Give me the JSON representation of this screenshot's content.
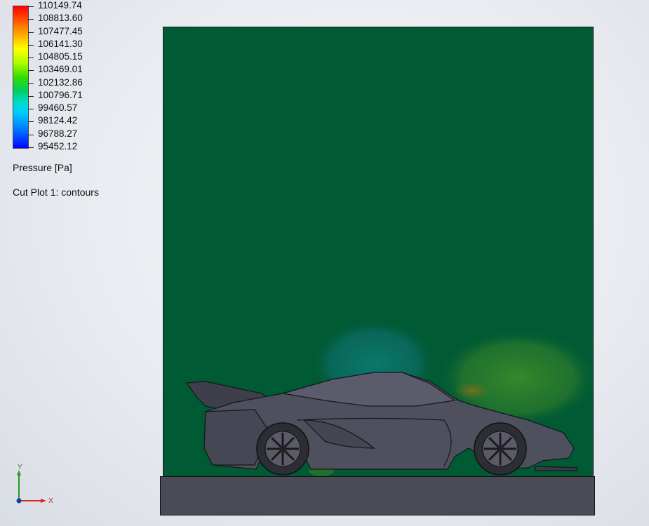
{
  "legend": {
    "ticks": [
      "110149.74",
      "108813.60",
      "107477.45",
      "106141.30",
      "104805.15",
      "103469.01",
      "102132.86",
      "100796.71",
      "99460.57",
      "98124.42",
      "96788.27",
      "95452.12"
    ],
    "quantity": "Pressure [Pa]",
    "plot_name": "Cut Plot 1: contours",
    "colors": {
      "max": "#ff0000",
      "mid": "#00cc66",
      "min": "#0000ff"
    }
  },
  "scene": {
    "background_field_color": "#005a34",
    "low_pressure_color": "#0a6e66",
    "high_pressure_color": "#2e7a2a",
    "car_color": "#4f505e",
    "ground_color": "#4a4b55"
  },
  "triad": {
    "y_label": "Y",
    "x_label": "X"
  }
}
